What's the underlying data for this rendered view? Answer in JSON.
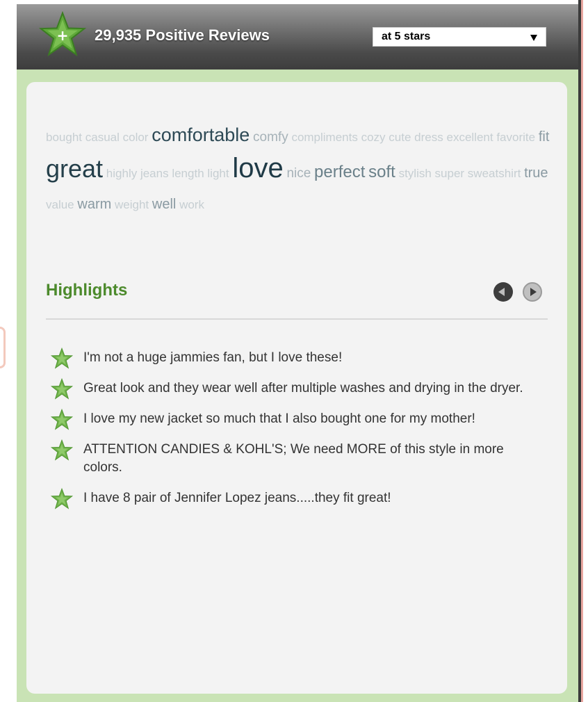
{
  "header": {
    "title": "29,935 Positive Reviews",
    "select_value": "at 5 stars",
    "icon": "plus-star-icon"
  },
  "word_cloud": [
    {
      "word": "bought",
      "size": 1
    },
    {
      "word": "casual",
      "size": 1
    },
    {
      "word": "color",
      "size": 1
    },
    {
      "word": "comfortable",
      "size": 5
    },
    {
      "word": "comfy",
      "size": 2
    },
    {
      "word": "compliments",
      "size": 1
    },
    {
      "word": "cozy",
      "size": 1
    },
    {
      "word": "cute",
      "size": 1
    },
    {
      "word": "dress",
      "size": 1
    },
    {
      "word": "excellent",
      "size": 1
    },
    {
      "word": "favorite",
      "size": 1
    },
    {
      "word": "fit",
      "size": 3
    },
    {
      "word": "great",
      "size": 6
    },
    {
      "word": "highly",
      "size": 1
    },
    {
      "word": "jeans",
      "size": 1
    },
    {
      "word": "length",
      "size": 1
    },
    {
      "word": "light",
      "size": 1
    },
    {
      "word": "love",
      "size": 7
    },
    {
      "word": "nice",
      "size": 2
    },
    {
      "word": "perfect",
      "size": 4
    },
    {
      "word": "soft",
      "size": 4
    },
    {
      "word": "stylish",
      "size": 1
    },
    {
      "word": "super",
      "size": 1
    },
    {
      "word": "sweatshirt",
      "size": 1
    },
    {
      "word": "true",
      "size": 3
    },
    {
      "word": "value",
      "size": 1
    },
    {
      "word": "warm",
      "size": 3
    },
    {
      "word": "weight",
      "size": 1
    },
    {
      "word": "well",
      "size": 3
    },
    {
      "word": "work",
      "size": 1
    }
  ],
  "highlights": {
    "title": "Highlights",
    "prev_icon": "chevron-left-icon",
    "next_icon": "chevron-right-icon",
    "items": [
      "I'm not a huge jammies fan, but I love these!",
      "Great look and they wear well after multiple washes and drying in the dryer.",
      "I love my new jacket so much that I also bought one for my mother!",
      "ATTENTION CANDIES & KOHL'S; We need MORE of this style in more colors.",
      "I have 8 pair of Jennifer Lopez jeans.....they fit great!"
    ]
  },
  "colors": {
    "accent_green": "#4c8a2c",
    "panel_bg": "#f3f3f3",
    "outer_green": "#c9e3b5",
    "star_green": "#6fb24a"
  }
}
